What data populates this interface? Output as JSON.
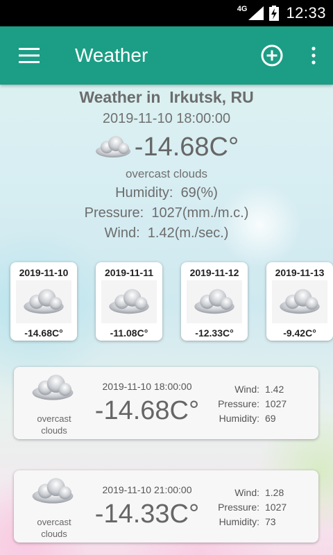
{
  "status_bar": {
    "network": "4G",
    "time": "12:33"
  },
  "toolbar": {
    "title": "Weather"
  },
  "current": {
    "city_prefix": "Weather in",
    "city": "Irkutsk, RU",
    "datetime": "2019-11-10 18:00:00",
    "temperature": "-14.68C°",
    "condition": "overcast clouds",
    "humidity_label": "Humidity:",
    "humidity_value": "69(%)",
    "pressure_label": "Pressure:",
    "pressure_value": "1027(mm./m.c.)",
    "wind_label": "Wind:",
    "wind_value": "1.42(m./sec.)",
    "icon": "cloud-icon"
  },
  "forecast_days": [
    {
      "date": "2019-11-10",
      "temp": "-14.68C°",
      "icon": "cloud-icon"
    },
    {
      "date": "2019-11-11",
      "temp": "-11.08C°",
      "icon": "cloud-icon"
    },
    {
      "date": "2019-11-12",
      "temp": "-12.33C°",
      "icon": "cloud-icon"
    },
    {
      "date": "2019-11-13",
      "temp": "-9.42C°",
      "icon": "cloud-icon"
    }
  ],
  "hourly": [
    {
      "datetime": "2019-11-10 18:00:00",
      "temp": "-14.68C°",
      "condition_line1": "overcast",
      "condition_line2": "clouds",
      "wind_label": "Wind:",
      "wind": "1.42",
      "pressure_label": "Pressure:",
      "pressure": "1027",
      "humidity_label": "Humidity:",
      "humidity": "69"
    },
    {
      "datetime": "2019-11-10 21:00:00",
      "temp": "-14.33C°",
      "condition_line1": "overcast",
      "condition_line2": "clouds",
      "wind_label": "Wind:",
      "wind": "1.28",
      "pressure_label": "Pressure:",
      "pressure": "1027",
      "humidity_label": "Humidity:",
      "humidity": "73"
    }
  ],
  "colors": {
    "toolbar": "#1b9e85",
    "status_bar": "#000000",
    "text": "#666666"
  }
}
